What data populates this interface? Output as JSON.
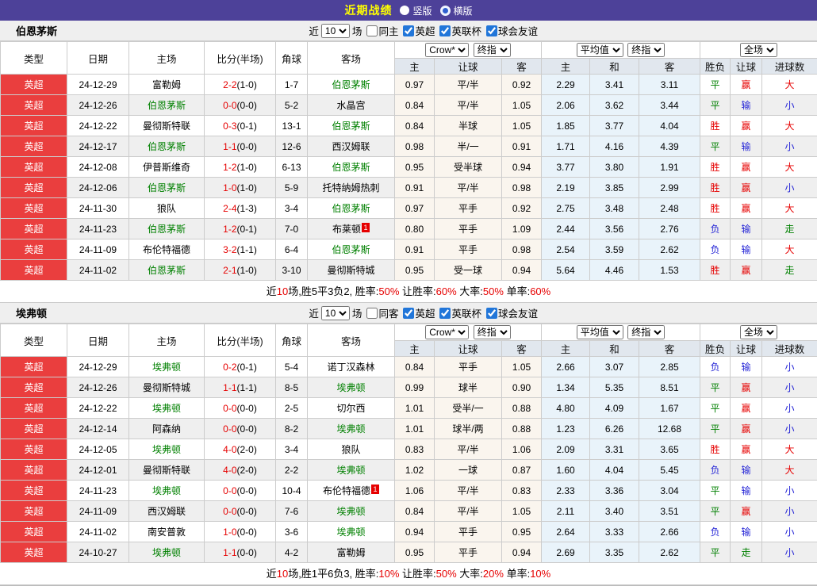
{
  "title_bar": {
    "title": "近期战绩",
    "options": [
      {
        "label": "竖版",
        "selected": true
      },
      {
        "label": "横版",
        "selected": false
      }
    ]
  },
  "table_header": {
    "cols": [
      "类型",
      "日期",
      "主场",
      "比分(半场)",
      "角球",
      "客场"
    ],
    "odds_group": {
      "select1": "Crow*",
      "select2": "终指",
      "cols": [
        "主",
        "让球",
        "客"
      ]
    },
    "avg_group": {
      "select1": "平均值",
      "select2": "终指",
      "cols": [
        "主",
        "和",
        "客"
      ]
    },
    "full_group": {
      "select": "全场",
      "cols": [
        "胜负",
        "让球",
        "进球数"
      ]
    }
  },
  "sections": [
    {
      "team": "伯恩茅斯",
      "filters": {
        "near": "近",
        "count": "10",
        "unit": "场",
        "same": "同主",
        "same_checked": false,
        "leagues": [
          "英超",
          "英联杯",
          "球会友谊"
        ],
        "leagues_checked": [
          true,
          true,
          true
        ]
      },
      "rows": [
        {
          "league": "英超",
          "date": "24-12-29",
          "home": "富勒姆",
          "home_self": false,
          "score": "2-2",
          "half": "(1-0)",
          "corners": "1-7",
          "away": "伯恩茅斯",
          "away_self": true,
          "away_badge": "",
          "odds": [
            "0.97",
            "平/半",
            "0.92"
          ],
          "avg": [
            "2.29",
            "3.41",
            "3.11"
          ],
          "results": [
            [
              "平",
              "g"
            ],
            [
              "赢",
              "r"
            ],
            [
              "大",
              "r"
            ]
          ]
        },
        {
          "league": "英超",
          "date": "24-12-26",
          "home": "伯恩茅斯",
          "home_self": true,
          "score": "0-0",
          "half": "(0-0)",
          "corners": "5-2",
          "away": "水晶宫",
          "away_self": false,
          "away_badge": "",
          "odds": [
            "0.84",
            "平/半",
            "1.05"
          ],
          "avg": [
            "2.06",
            "3.62",
            "3.44"
          ],
          "results": [
            [
              "平",
              "g"
            ],
            [
              "输",
              "b"
            ],
            [
              "小",
              "b"
            ]
          ]
        },
        {
          "league": "英超",
          "date": "24-12-22",
          "home": "曼彻斯特联",
          "home_self": false,
          "score": "0-3",
          "half": "(0-1)",
          "corners": "13-1",
          "away": "伯恩茅斯",
          "away_self": true,
          "away_badge": "",
          "odds": [
            "0.84",
            "半球",
            "1.05"
          ],
          "avg": [
            "1.85",
            "3.77",
            "4.04"
          ],
          "results": [
            [
              "胜",
              "r"
            ],
            [
              "赢",
              "r"
            ],
            [
              "大",
              "r"
            ]
          ]
        },
        {
          "league": "英超",
          "date": "24-12-17",
          "home": "伯恩茅斯",
          "home_self": true,
          "score": "1-1",
          "half": "(0-0)",
          "corners": "12-6",
          "away": "西汉姆联",
          "away_self": false,
          "away_badge": "",
          "odds": [
            "0.98",
            "半/一",
            "0.91"
          ],
          "avg": [
            "1.71",
            "4.16",
            "4.39"
          ],
          "results": [
            [
              "平",
              "g"
            ],
            [
              "输",
              "b"
            ],
            [
              "小",
              "b"
            ]
          ]
        },
        {
          "league": "英超",
          "date": "24-12-08",
          "home": "伊普斯维奇",
          "home_self": false,
          "score": "1-2",
          "half": "(1-0)",
          "corners": "6-13",
          "away": "伯恩茅斯",
          "away_self": true,
          "away_badge": "",
          "odds": [
            "0.95",
            "受半球",
            "0.94"
          ],
          "avg": [
            "3.77",
            "3.80",
            "1.91"
          ],
          "results": [
            [
              "胜",
              "r"
            ],
            [
              "赢",
              "r"
            ],
            [
              "大",
              "r"
            ]
          ]
        },
        {
          "league": "英超",
          "date": "24-12-06",
          "home": "伯恩茅斯",
          "home_self": true,
          "score": "1-0",
          "half": "(1-0)",
          "corners": "5-9",
          "away": "托特纳姆热刺",
          "away_self": false,
          "away_badge": "",
          "odds": [
            "0.91",
            "平/半",
            "0.98"
          ],
          "avg": [
            "2.19",
            "3.85",
            "2.99"
          ],
          "results": [
            [
              "胜",
              "r"
            ],
            [
              "赢",
              "r"
            ],
            [
              "小",
              "b"
            ]
          ]
        },
        {
          "league": "英超",
          "date": "24-11-30",
          "home": "狼队",
          "home_self": false,
          "score": "2-4",
          "half": "(1-3)",
          "corners": "3-4",
          "away": "伯恩茅斯",
          "away_self": true,
          "away_badge": "",
          "odds": [
            "0.97",
            "平手",
            "0.92"
          ],
          "avg": [
            "2.75",
            "3.48",
            "2.48"
          ],
          "results": [
            [
              "胜",
              "r"
            ],
            [
              "赢",
              "r"
            ],
            [
              "大",
              "r"
            ]
          ]
        },
        {
          "league": "英超",
          "date": "24-11-23",
          "home": "伯恩茅斯",
          "home_self": true,
          "score": "1-2",
          "half": "(0-1)",
          "corners": "7-0",
          "away": "布莱顿",
          "away_self": false,
          "away_badge": "1",
          "odds": [
            "0.80",
            "平手",
            "1.09"
          ],
          "avg": [
            "2.44",
            "3.56",
            "2.76"
          ],
          "results": [
            [
              "负",
              "b"
            ],
            [
              "输",
              "b"
            ],
            [
              "走",
              "g"
            ]
          ]
        },
        {
          "league": "英超",
          "date": "24-11-09",
          "home": "布伦特福德",
          "home_self": false,
          "score": "3-2",
          "half": "(1-1)",
          "corners": "6-4",
          "away": "伯恩茅斯",
          "away_self": true,
          "away_badge": "",
          "odds": [
            "0.91",
            "平手",
            "0.98"
          ],
          "avg": [
            "2.54",
            "3.59",
            "2.62"
          ],
          "results": [
            [
              "负",
              "b"
            ],
            [
              "输",
              "b"
            ],
            [
              "大",
              "r"
            ]
          ]
        },
        {
          "league": "英超",
          "date": "24-11-02",
          "home": "伯恩茅斯",
          "home_self": true,
          "score": "2-1",
          "half": "(1-0)",
          "corners": "3-10",
          "away": "曼彻斯特城",
          "away_self": false,
          "away_badge": "",
          "odds": [
            "0.95",
            "受一球",
            "0.94"
          ],
          "avg": [
            "5.64",
            "4.46",
            "1.53"
          ],
          "results": [
            [
              "胜",
              "r"
            ],
            [
              "赢",
              "r"
            ],
            [
              "走",
              "g"
            ]
          ]
        }
      ],
      "summary": [
        [
          "近",
          0
        ],
        [
          "10",
          1
        ],
        [
          "场,胜5平3负2, 胜率:",
          0
        ],
        [
          "50%",
          1
        ],
        [
          " 让胜率:",
          0
        ],
        [
          "60%",
          1
        ],
        [
          " 大率:",
          0
        ],
        [
          "50%",
          1
        ],
        [
          " 单率:",
          0
        ],
        [
          "60%",
          1
        ]
      ]
    },
    {
      "team": "埃弗顿",
      "filters": {
        "near": "近",
        "count": "10",
        "unit": "场",
        "same": "同客",
        "same_checked": false,
        "leagues": [
          "英超",
          "英联杯",
          "球会友谊"
        ],
        "leagues_checked": [
          true,
          true,
          true
        ]
      },
      "rows": [
        {
          "league": "英超",
          "date": "24-12-29",
          "home": "埃弗顿",
          "home_self": true,
          "score": "0-2",
          "half": "(0-1)",
          "corners": "5-4",
          "away": "诺丁汉森林",
          "away_self": false,
          "away_badge": "",
          "odds": [
            "0.84",
            "平手",
            "1.05"
          ],
          "avg": [
            "2.66",
            "3.07",
            "2.85"
          ],
          "results": [
            [
              "负",
              "b"
            ],
            [
              "输",
              "b"
            ],
            [
              "小",
              "b"
            ]
          ]
        },
        {
          "league": "英超",
          "date": "24-12-26",
          "home": "曼彻斯特城",
          "home_self": false,
          "score": "1-1",
          "half": "(1-1)",
          "corners": "8-5",
          "away": "埃弗顿",
          "away_self": true,
          "away_badge": "",
          "odds": [
            "0.99",
            "球半",
            "0.90"
          ],
          "avg": [
            "1.34",
            "5.35",
            "8.51"
          ],
          "results": [
            [
              "平",
              "g"
            ],
            [
              "赢",
              "r"
            ],
            [
              "小",
              "b"
            ]
          ]
        },
        {
          "league": "英超",
          "date": "24-12-22",
          "home": "埃弗顿",
          "home_self": true,
          "score": "0-0",
          "half": "(0-0)",
          "corners": "2-5",
          "away": "切尔西",
          "away_self": false,
          "away_badge": "",
          "odds": [
            "1.01",
            "受半/一",
            "0.88"
          ],
          "avg": [
            "4.80",
            "4.09",
            "1.67"
          ],
          "results": [
            [
              "平",
              "g"
            ],
            [
              "赢",
              "r"
            ],
            [
              "小",
              "b"
            ]
          ]
        },
        {
          "league": "英超",
          "date": "24-12-14",
          "home": "阿森纳",
          "home_self": false,
          "score": "0-0",
          "half": "(0-0)",
          "corners": "8-2",
          "away": "埃弗顿",
          "away_self": true,
          "away_badge": "",
          "odds": [
            "1.01",
            "球半/两",
            "0.88"
          ],
          "avg": [
            "1.23",
            "6.26",
            "12.68"
          ],
          "results": [
            [
              "平",
              "g"
            ],
            [
              "赢",
              "r"
            ],
            [
              "小",
              "b"
            ]
          ]
        },
        {
          "league": "英超",
          "date": "24-12-05",
          "home": "埃弗顿",
          "home_self": true,
          "score": "4-0",
          "half": "(2-0)",
          "corners": "3-4",
          "away": "狼队",
          "away_self": false,
          "away_badge": "",
          "odds": [
            "0.83",
            "平/半",
            "1.06"
          ],
          "avg": [
            "2.09",
            "3.31",
            "3.65"
          ],
          "results": [
            [
              "胜",
              "r"
            ],
            [
              "赢",
              "r"
            ],
            [
              "大",
              "r"
            ]
          ]
        },
        {
          "league": "英超",
          "date": "24-12-01",
          "home": "曼彻斯特联",
          "home_self": false,
          "score": "4-0",
          "half": "(2-0)",
          "corners": "2-2",
          "away": "埃弗顿",
          "away_self": true,
          "away_badge": "",
          "odds": [
            "1.02",
            "一球",
            "0.87"
          ],
          "avg": [
            "1.60",
            "4.04",
            "5.45"
          ],
          "results": [
            [
              "负",
              "b"
            ],
            [
              "输",
              "b"
            ],
            [
              "大",
              "r"
            ]
          ]
        },
        {
          "league": "英超",
          "date": "24-11-23",
          "home": "埃弗顿",
          "home_self": true,
          "score": "0-0",
          "half": "(0-0)",
          "corners": "10-4",
          "away": "布伦特福德",
          "away_self": false,
          "away_badge": "1",
          "odds": [
            "1.06",
            "平/半",
            "0.83"
          ],
          "avg": [
            "2.33",
            "3.36",
            "3.04"
          ],
          "results": [
            [
              "平",
              "g"
            ],
            [
              "输",
              "b"
            ],
            [
              "小",
              "b"
            ]
          ]
        },
        {
          "league": "英超",
          "date": "24-11-09",
          "home": "西汉姆联",
          "home_self": false,
          "score": "0-0",
          "half": "(0-0)",
          "corners": "7-6",
          "away": "埃弗顿",
          "away_self": true,
          "away_badge": "",
          "odds": [
            "0.84",
            "平/半",
            "1.05"
          ],
          "avg": [
            "2.11",
            "3.40",
            "3.51"
          ],
          "results": [
            [
              "平",
              "g"
            ],
            [
              "赢",
              "r"
            ],
            [
              "小",
              "b"
            ]
          ]
        },
        {
          "league": "英超",
          "date": "24-11-02",
          "home": "南安普敦",
          "home_self": false,
          "score": "1-0",
          "half": "(0-0)",
          "corners": "3-6",
          "away": "埃弗顿",
          "away_self": true,
          "away_badge": "",
          "odds": [
            "0.94",
            "平手",
            "0.95"
          ],
          "avg": [
            "2.64",
            "3.33",
            "2.66"
          ],
          "results": [
            [
              "负",
              "b"
            ],
            [
              "输",
              "b"
            ],
            [
              "小",
              "b"
            ]
          ]
        },
        {
          "league": "英超",
          "date": "24-10-27",
          "home": "埃弗顿",
          "home_self": true,
          "score": "1-1",
          "half": "(0-0)",
          "corners": "4-2",
          "away": "富勒姆",
          "away_self": false,
          "away_badge": "",
          "odds": [
            "0.95",
            "平手",
            "0.94"
          ],
          "avg": [
            "2.69",
            "3.35",
            "2.62"
          ],
          "results": [
            [
              "平",
              "g"
            ],
            [
              "走",
              "g"
            ],
            [
              "小",
              "b"
            ]
          ]
        }
      ],
      "summary": [
        [
          "近",
          0
        ],
        [
          "10",
          1
        ],
        [
          "场,胜1平6负3, 胜率:",
          0
        ],
        [
          "10%",
          1
        ],
        [
          " 让胜率:",
          0
        ],
        [
          "50%",
          1
        ],
        [
          " 大率:",
          0
        ],
        [
          "20%",
          1
        ],
        [
          " 单率:",
          0
        ],
        [
          "10%",
          1
        ]
      ]
    }
  ],
  "colors": {
    "titlebar_bg": "#4D4199",
    "title_text": "#FFFF00",
    "league_badge_bg": "#EA3E3E",
    "self_team": "#008000",
    "win_red": "#E60000",
    "lose_blue": "#2424D6",
    "draw_green": "#008000",
    "odds_col_bg": "#FAF5EE",
    "avg_col_bg": "#E9F3FA",
    "header_bg": "#E1E7EE"
  }
}
